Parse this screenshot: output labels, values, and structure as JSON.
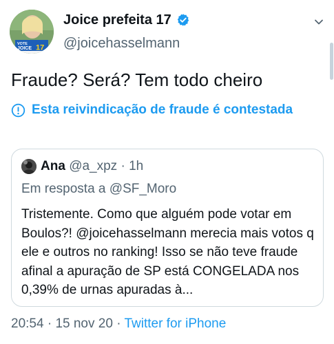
{
  "author": {
    "display_name": "Joice prefeita 17",
    "handle": "@joicehasselmann",
    "avatar_banner": "VOTE JOICE 17"
  },
  "tweet": {
    "text": "Fraude? Será? Tem todo cheiro"
  },
  "notice": {
    "text": "Esta reivindicação de fraude é contestada"
  },
  "quoted": {
    "name": "Ana",
    "handle": "@a_xpz",
    "separator": "·",
    "time": "1h",
    "reply_to": "Em resposta a @SF_Moro",
    "body": "Tristemente. Como que alguém pode votar em Boulos?! @joicehasselmann merecia mais votos q ele e outros no ranking! Isso se não teve fraude afinal a apuração de SP está CONGELADA nos 0,39% de urnas apuradas à..."
  },
  "meta": {
    "time": "20:54",
    "separator1": "·",
    "date": "15 nov 20",
    "separator2": "·",
    "source": "Twitter for iPhone"
  },
  "colors": {
    "accent": "#1d9bf0",
    "secondary_text": "#536471",
    "border": "#cfd9de"
  },
  "icons": {
    "verified": "verified-badge-icon",
    "more": "chevron-down-icon",
    "notice": "info-circle-icon"
  }
}
